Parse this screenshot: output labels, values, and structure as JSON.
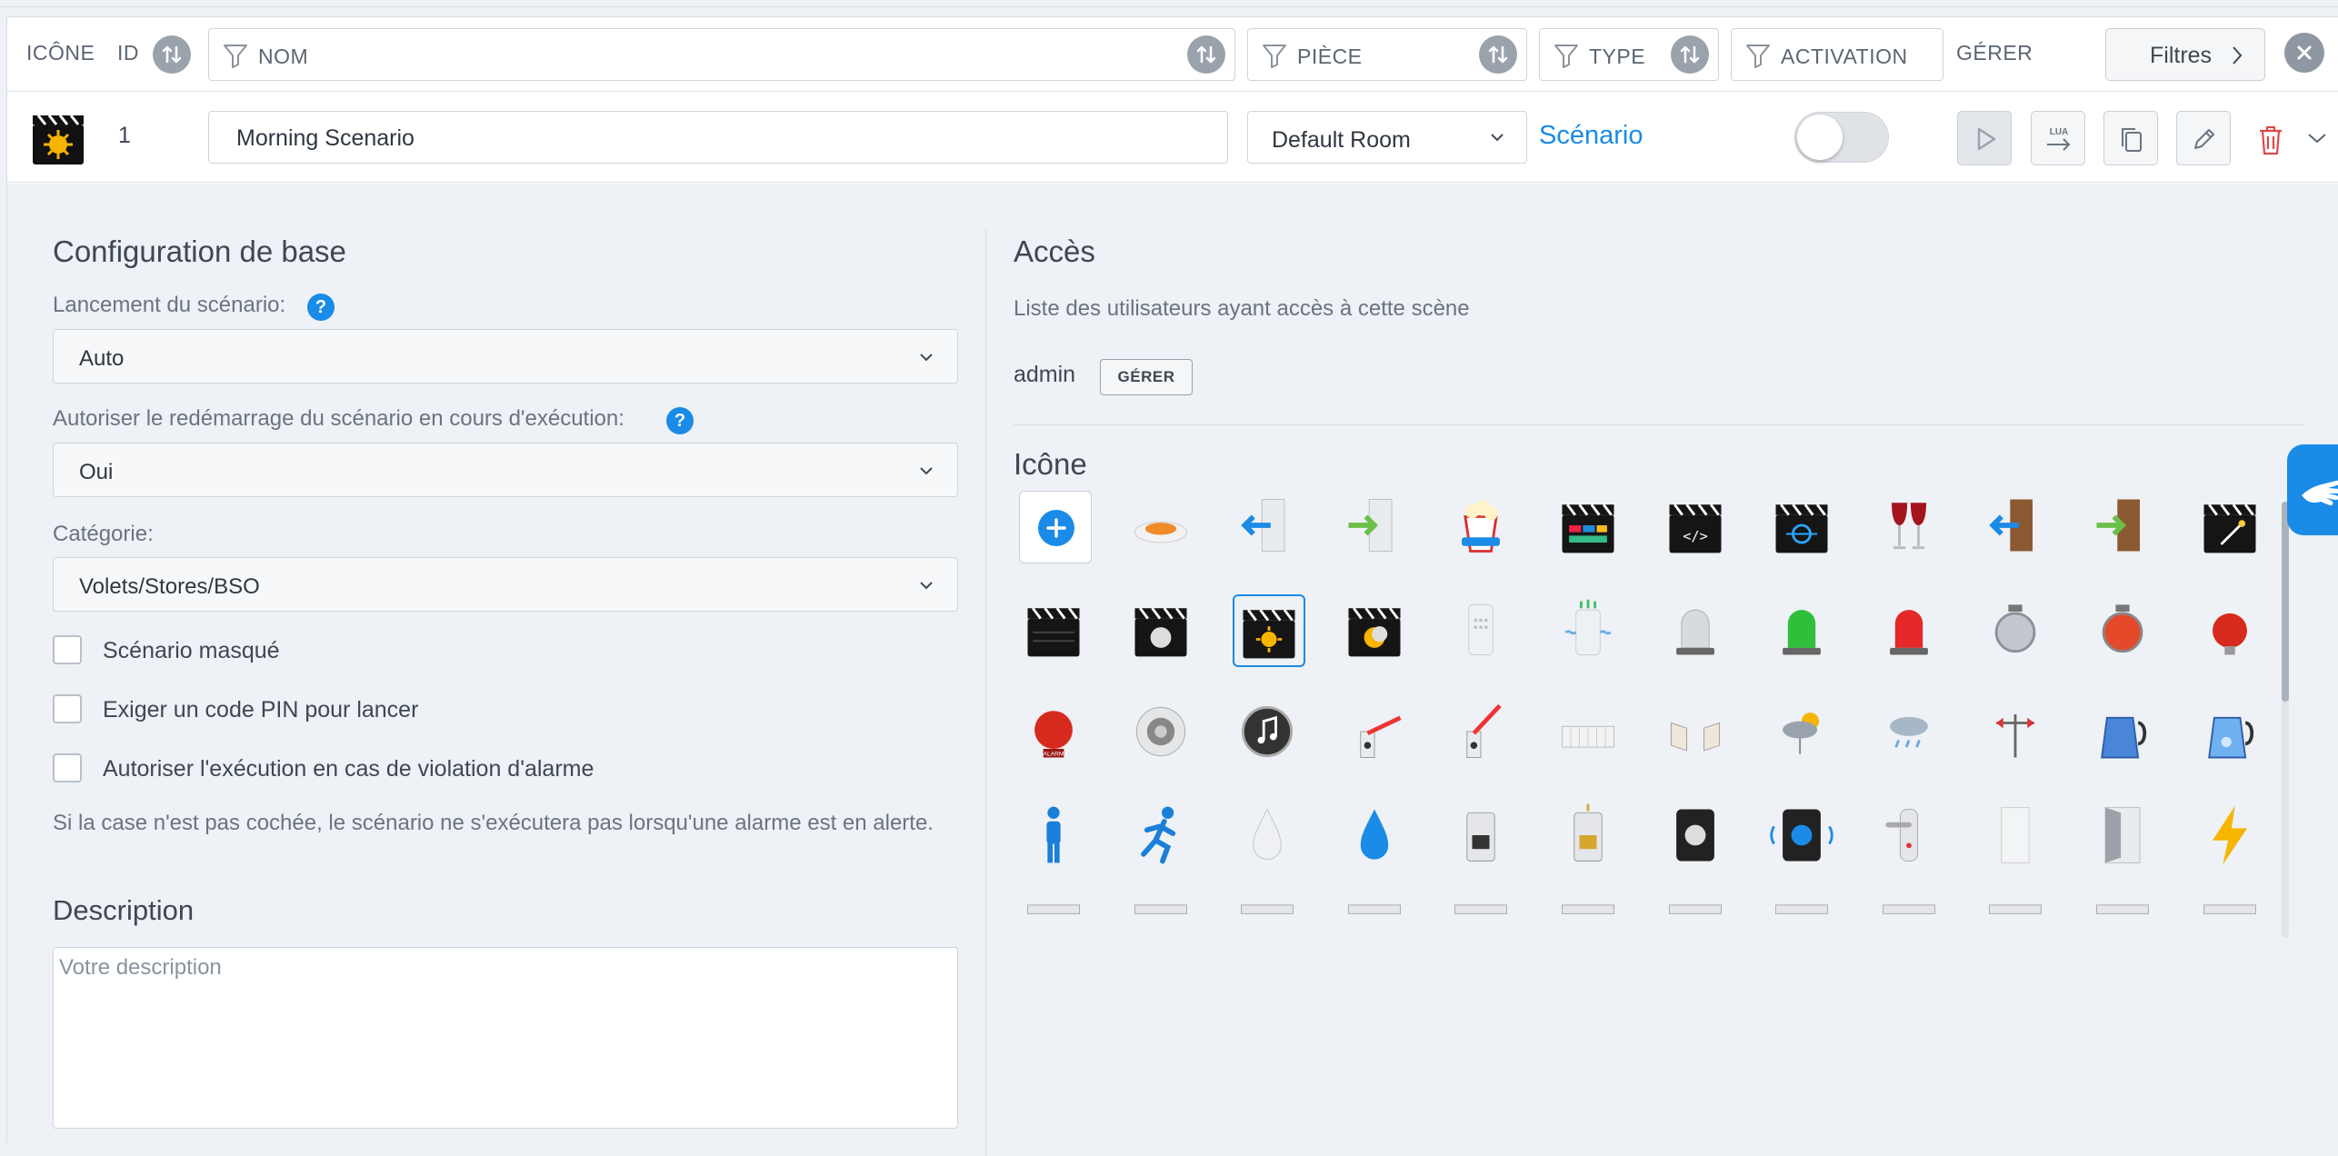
{
  "header": {
    "col_icon": "ICÔNE",
    "col_id": "ID",
    "col_name": "NOM",
    "col_room": "PIÈCE",
    "col_type": "TYPE",
    "col_activation": "ACTIVATION",
    "col_manage": "GÉRER",
    "filters_button": "Filtres"
  },
  "scenario": {
    "id": "1",
    "name": "Morning Scenario",
    "room": "Default Room",
    "type": "Scénario",
    "enabled": false
  },
  "config": {
    "title": "Configuration de base",
    "launch_label": "Lancement du scénario:",
    "launch_value": "Auto",
    "restart_label": "Autoriser le redémarrage du scénario en cours d'exécution:",
    "restart_value": "Oui",
    "category_label": "Catégorie:",
    "category_value": "Volets/Stores/BSO",
    "help": "?",
    "checkboxes": [
      {
        "label": "Scénario masqué",
        "checked": false
      },
      {
        "label": "Exiger un code PIN pour lancer",
        "checked": false
      },
      {
        "label": "Autoriser l'exécution en cas de violation d'alarme",
        "checked": false
      }
    ],
    "alarm_note": "Si la case n'est pas cochée, le scénario ne s'exécutera pas lorsqu'une alarme est en alerte.",
    "description_title": "Description",
    "description_placeholder": "Votre description"
  },
  "access": {
    "title": "Accès",
    "subtitle": "Liste des utilisateurs ayant accès à cette scène",
    "user": "admin",
    "manage_button": "GÉRER"
  },
  "icons": {
    "title": "Icône",
    "selected_index": 14,
    "items": [
      "add-icon",
      "food-plate-icon",
      "door-exit-left-icon",
      "door-enter-right-icon",
      "popcorn-icon",
      "clapper-color-bars-icon",
      "clapper-code-icon",
      "clapper-network-icon",
      "wine-glasses-icon",
      "wood-door-exit-icon",
      "wood-door-enter-icon",
      "clapper-magic-icon",
      "clapper-plain-icon",
      "clapper-moon-icon",
      "clapper-sun-icon",
      "clapper-sun-moon-icon",
      "air-purifier-icon",
      "air-purifier-active-icon",
      "beacon-grey-icon",
      "beacon-green-icon",
      "beacon-red-icon",
      "bell-grey-icon",
      "bell-red-icon",
      "bell-alarm-red-icon",
      "alarm-siren-icon",
      "speaker-icon",
      "music-speaker-icon",
      "barrier-gate-icon",
      "barrier-gate-open-icon",
      "gate-closed-icon",
      "gate-open-icon",
      "weather-sun-cloud-icon",
      "weather-rain-icon",
      "wind-vane-icon",
      "kettle-icon",
      "kettle-active-icon",
      "person-standing-icon",
      "person-running-icon",
      "drop-white-icon",
      "drop-blue-icon",
      "coffee-machine-icon",
      "coffee-machine-active-icon",
      "doorbell-icon",
      "doorbell-active-icon",
      "door-handle-icon",
      "door-white-icon",
      "door-open-icon",
      "lightning-icon"
    ]
  }
}
